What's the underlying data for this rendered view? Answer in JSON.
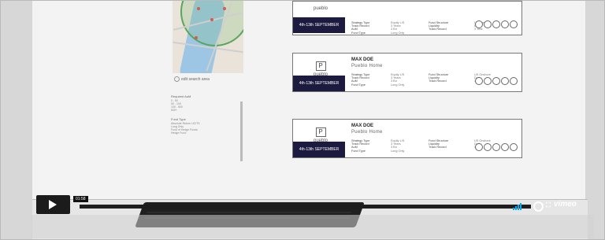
{
  "left_panel": {
    "search_area": "edit search area",
    "heading_1": "Required AuM",
    "range_lines": [
      "0 - 50",
      "50 - 100",
      "100 - 500",
      "500+"
    ],
    "heading_2": "Fund Type",
    "fund_lines": [
      "Absolute Return UCITS",
      "Long Only",
      "Fund of Hedge Funds",
      "Hedge Fund"
    ]
  },
  "cards": [
    {
      "top": true,
      "logo": "pueblo",
      "date": "4th-13th SEPTEMBER",
      "meta": [
        "Strategy Type",
        "Track Record",
        "AuM",
        "Fund Type"
      ],
      "values": [
        "Equity L/S",
        "3 Years",
        "3 Bn",
        "Long Only"
      ],
      "meta2": [
        "Fund Structure",
        "Liquidity",
        "Track Record"
      ],
      "values2": [
        "US Onshore",
        "Daily",
        "3 Year"
      ]
    },
    {
      "logo": "pueblo",
      "logo_letter": "P",
      "name": "MAX DOE",
      "home": "Pueblo Home",
      "date": "4th-13th SEPTEMBER",
      "meta": [
        "Strategy Type",
        "Track Record",
        "AuM",
        "Fund Type"
      ],
      "values": [
        "Equity L/S",
        "3 Years",
        "3 Bn",
        "Long Only"
      ],
      "meta2": [
        "Fund Structure",
        "Liquidity",
        "Track Record"
      ],
      "values2": [
        "US Onshore",
        "Daily",
        "3 Year"
      ]
    },
    {
      "logo": "pueblo",
      "logo_letter": "P",
      "name": "MAX DOE",
      "home": "Pueblo Home",
      "date": "4th-13th SEPTEMBER",
      "meta": [
        "Strategy Type",
        "Track Record",
        "AuM",
        "Fund Type"
      ],
      "values": [
        "Equity L/S",
        "3 Years",
        "3 Bn",
        "Long Only"
      ],
      "meta2": [
        "Fund Structure",
        "Liquidity",
        "Track Record"
      ],
      "values2": [
        "US Onshore",
        "Daily",
        "3 Year"
      ]
    }
  ],
  "player": {
    "time": "01:58",
    "brand": "vimeo",
    "accent": "#00adef"
  }
}
